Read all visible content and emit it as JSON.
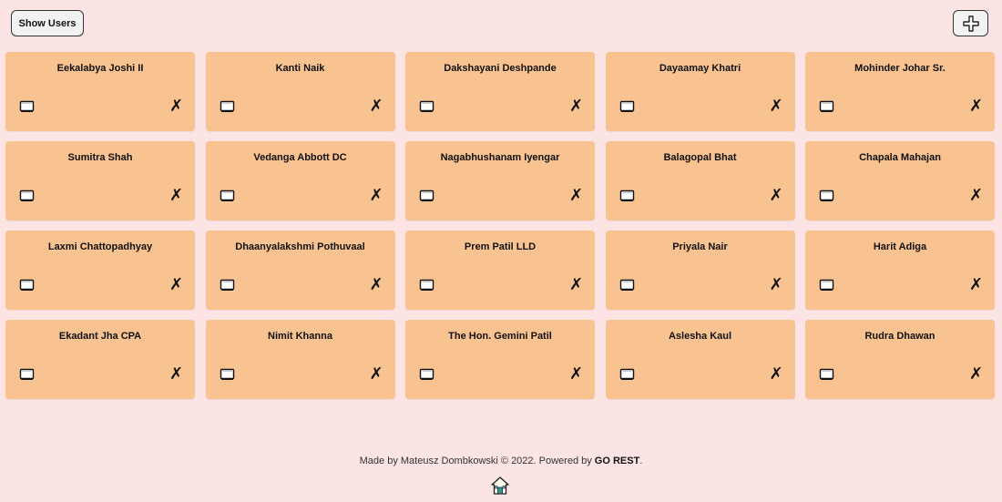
{
  "toolbar": {
    "show_users_label": "Show Users",
    "add_icon": "plus-icon"
  },
  "users": [
    "Eekalabya Joshi II",
    "Kanti Naik",
    "Dakshayani Deshpande",
    "Dayaamay Khatri",
    "Mohinder Johar Sr.",
    "Sumitra Shah",
    "Vedanga Abbott DC",
    "Nagabhushanam Iyengar",
    "Balagopal Bhat",
    "Chapala Mahajan",
    "Laxmi Chattopadhyay",
    "Dhaanyalakshmi Pothuvaal",
    "Prem Patil LLD",
    "Priyala Nair",
    "Harit Adiga",
    "Ekadant Jha CPA",
    "Nimit Khanna",
    "The Hon. Gemini Patil",
    "Aslesha Kaul",
    "Rudra Dhawan"
  ],
  "card": {
    "details_icon": "book-icon",
    "delete_icon": "x-mark-icon",
    "delete_glyph": "✗"
  },
  "footer": {
    "prefix": "Made by Mateusz Dombkowski © 2022. Powered by ",
    "brand": "GO REST",
    "suffix": ".",
    "home_icon": "home-icon"
  },
  "colors": {
    "background": "#fde4e4",
    "card": "#f8c291",
    "button": "#f2f2f2"
  }
}
